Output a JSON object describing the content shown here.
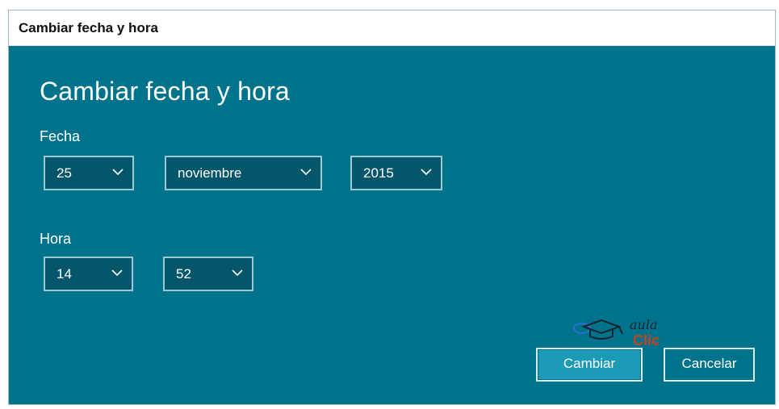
{
  "window": {
    "title": "Cambiar fecha y hora"
  },
  "dialog": {
    "heading": "Cambiar fecha y hora",
    "fecha_label": "Fecha",
    "hora_label": "Hora",
    "day": {
      "value": "25"
    },
    "month": {
      "value": "noviembre"
    },
    "year": {
      "value": "2015"
    },
    "hour": {
      "value": "14"
    },
    "minute": {
      "value": "52"
    },
    "buttons": {
      "change": "Cambiar",
      "cancel": "Cancelar"
    }
  },
  "logo": {
    "line1": "aula",
    "line2": "Clic"
  },
  "colors": {
    "background": "#00738c",
    "dropdown": "#05566a",
    "primary_button": "#1c9bb6",
    "logo_red": "#c8411a"
  },
  "icons": {
    "dropdown": "chevron-down-icon",
    "logo": "graduation-cap-icon"
  }
}
